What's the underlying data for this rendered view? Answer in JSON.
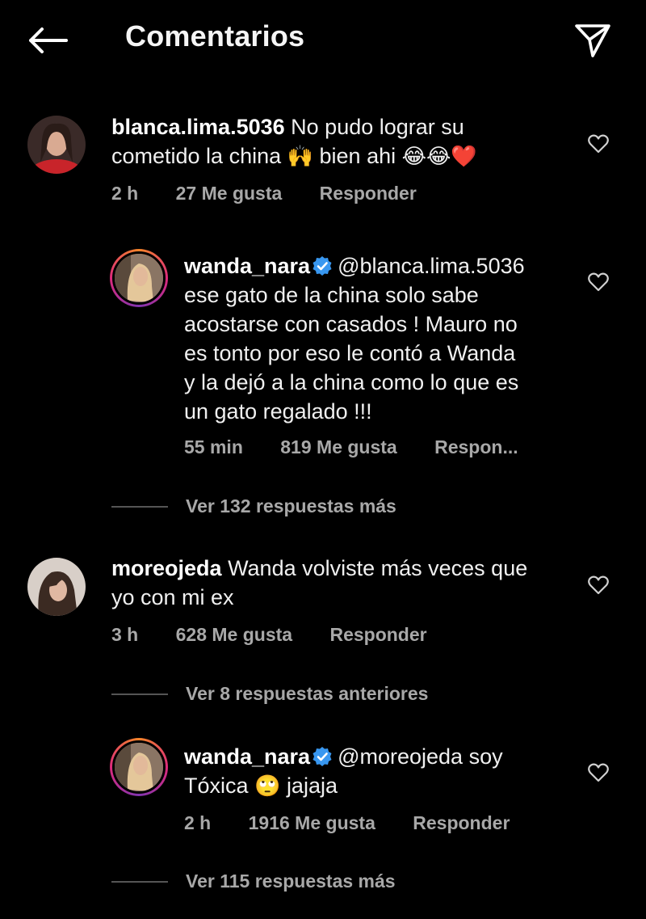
{
  "header": {
    "title": "Comentarios",
    "back_icon": "arrow-left-icon",
    "share_icon": "paper-plane-icon"
  },
  "comments": [
    {
      "username": "blanca.lima.5036",
      "text_line1": "No pudo lograr su",
      "text_line2_a": "cometido la china",
      "text_line2_b": "bien ahi",
      "emoji_hands": "🙌",
      "emoji_laugh": "😂😂",
      "emoji_heart": "❤️",
      "time": "2 h",
      "likes": "27 Me gusta",
      "reply": "Responder"
    },
    {
      "username": "wanda_nara",
      "mention": "@blanca.lima.5036",
      "lines": [
        "ese gato de la china solo sabe",
        "acostarse con casados ! Mauro no",
        "es tonto por eso le contó a Wanda",
        "y la dejó a la china  como lo que es",
        "un gato regalado !!!"
      ],
      "time": "55 min",
      "likes": "819 Me gusta",
      "reply": "Respon..."
    },
    {
      "username": "moreojeda",
      "text_line1": "Wanda volviste más veces que",
      "text_line2": "yo con mi ex",
      "time": "3 h",
      "likes": "628 Me gusta",
      "reply": "Responder"
    },
    {
      "username": "wanda_nara",
      "mention": "@moreojeda soy",
      "text_line2_a": "Tóxica",
      "emoji_eyes": "🙄",
      "text_line2_b": "jajaja",
      "time": "2 h",
      "likes": "1916 Me gusta",
      "reply": "Responder"
    }
  ],
  "view_more": {
    "first": "Ver 132 respuestas más",
    "previous": "Ver 8 respuestas anteriores",
    "last": "Ver 115 respuestas más"
  },
  "colors": {
    "background": "#000000",
    "text": "#f5f5f5",
    "meta": "#a8a8a8",
    "verified": "#3897f0"
  }
}
